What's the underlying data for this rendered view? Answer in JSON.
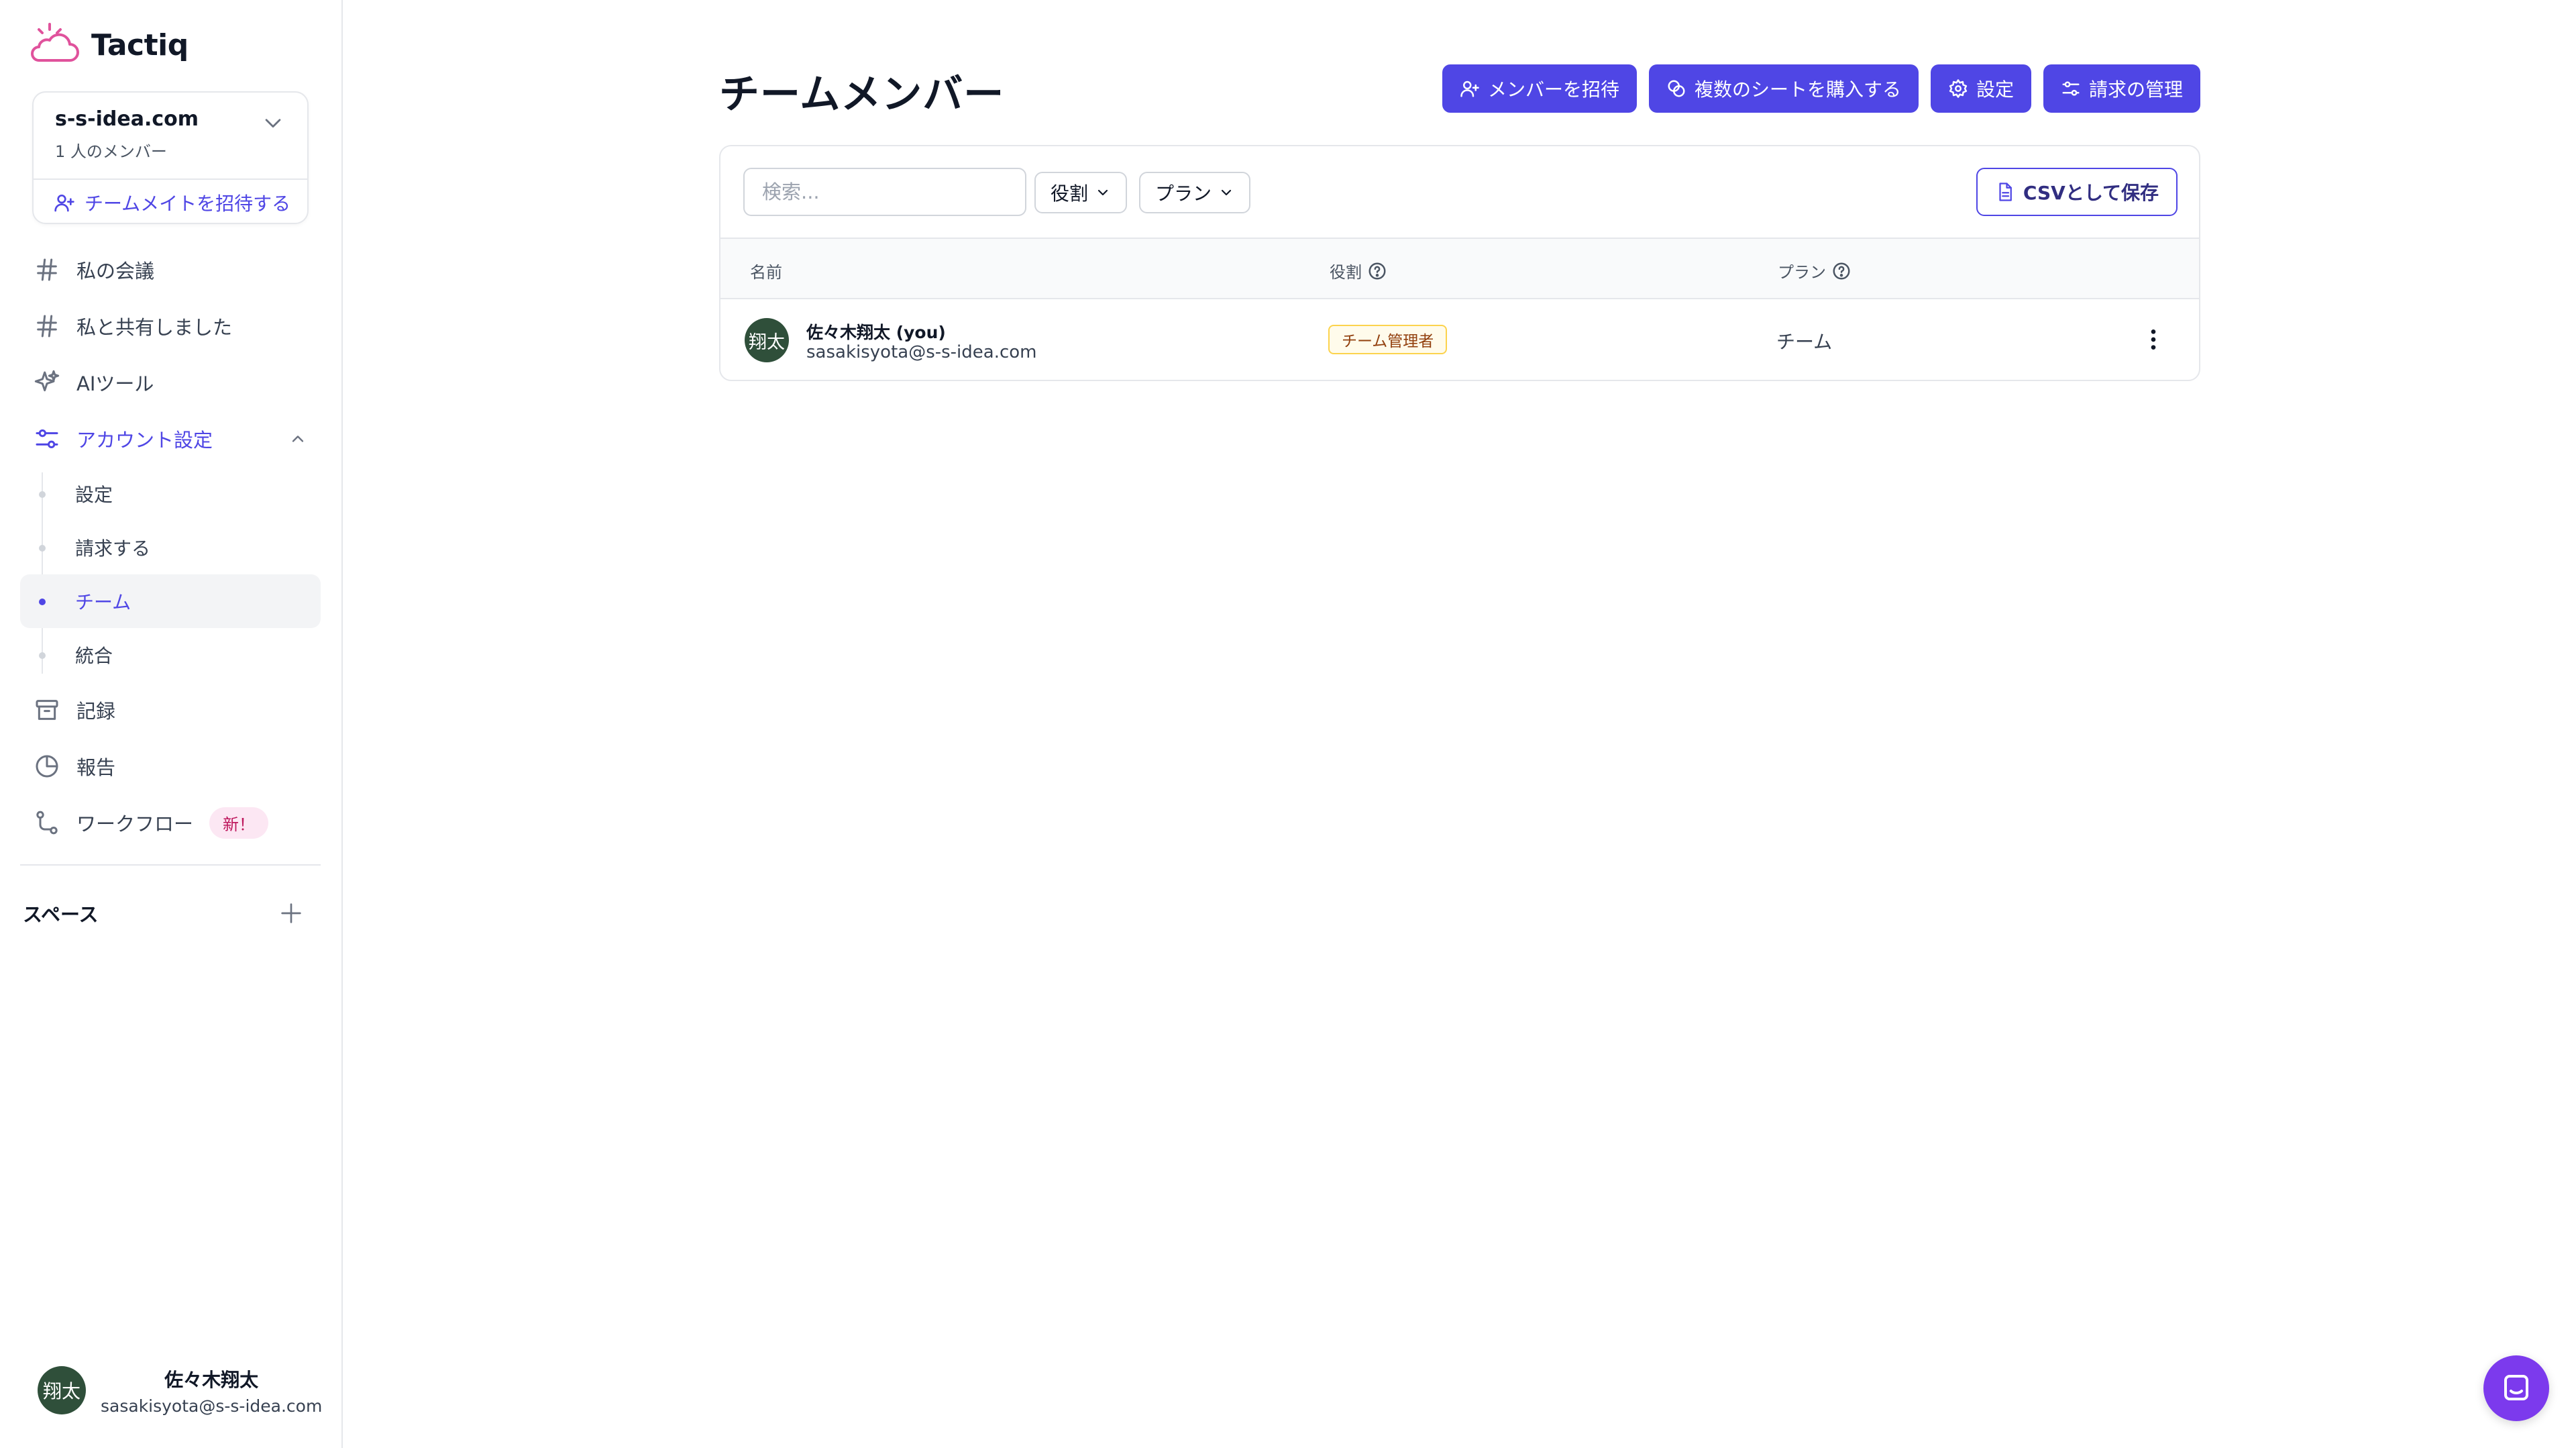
{
  "brand": {
    "name": "Tactiq",
    "logo_icon": "cloud-logo-icon",
    "accent": "#4f46e5",
    "logo_color": "#e0529c"
  },
  "workspace": {
    "domain": "s-s-idea.com",
    "members": "1 人のメンバー",
    "invite_label": "チームメイトを招待する"
  },
  "nav": {
    "my_meetings": "私の会議",
    "shared_with_me": "私と共有しました",
    "ai_tools": "AIツール",
    "account_settings": "アカウント設定",
    "sub": {
      "settings": "設定",
      "billing": "請求する",
      "team": "チーム",
      "integrations": "統合"
    },
    "records": "記録",
    "reports": "報告",
    "workflow": "ワークフロー",
    "workflow_badge": "新！"
  },
  "spaces": {
    "label": "スペース"
  },
  "user": {
    "initials": "翔太",
    "name": "佐々木翔太",
    "email": "sasakisyota@s-s-idea.com"
  },
  "page": {
    "title": "チームメンバー"
  },
  "actions": {
    "invite_members": "メンバーを招待",
    "buy_seats": "複数のシートを購入する",
    "settings": "設定",
    "manage_billing": "請求の管理"
  },
  "toolbar": {
    "search_placeholder": "検索...",
    "role_filter": "役割",
    "plan_filter": "プラン",
    "export_csv": "CSVとして保存"
  },
  "table": {
    "columns": {
      "name": "名前",
      "role": "役割",
      "plan": "プラン"
    },
    "rows": [
      {
        "initials": "翔太",
        "name": "佐々木翔太 (you)",
        "email": "sasakisyota@s-s-idea.com",
        "role": "チーム管理者",
        "plan": "チーム"
      }
    ]
  }
}
